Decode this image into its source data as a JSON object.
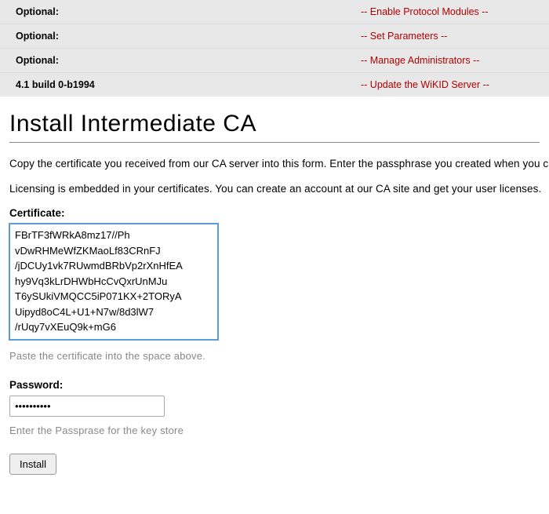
{
  "topRows": [
    {
      "label": "Optional:",
      "link": "-- Enable Protocol Modules --"
    },
    {
      "label": "Optional:",
      "link": "-- Set Parameters --"
    },
    {
      "label": "Optional:",
      "link": "-- Manage Administrators --"
    },
    {
      "label": "4.1 build 0-b1994",
      "link": "-- Update the WiKID Server --"
    }
  ],
  "heading": "Install Intermediate CA",
  "para1": "Copy the certificate you received from our CA server into this form. Enter the passphrase you created when you created the certificate request. Then cut and paste the certificate you recieved from WiKID.",
  "para2": "Licensing is embedded in your certificates. You can create an account at our CA site and get your user licenses.",
  "certLabel": "Certificate:",
  "certValue": "FBrTF3fWRkA8mz17//Ph\nvDwRHMeWfZKMaoLf83CRnFJ\n/jDCUy1vk7RUwmdBRbVp2rXnHfEA\nhy9Vq3kLrDHWbHcCvQxrUnMJu\nT6ySUkiVMQCC5iP071KX+2TORyA\nUipyd8oC4L+U1+N7w/8d3lW7\n/rUqy7vXEuQ9k+mG6",
  "certHint": "Paste the certificate into the space above.",
  "passLabel": "Password:",
  "passValue": "••••••••••",
  "passHint": "Enter the Passprase for the key store",
  "installLabel": "Install"
}
